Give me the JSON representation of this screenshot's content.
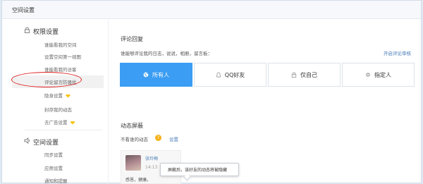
{
  "header": {
    "title": "空间设置"
  },
  "sidebar": {
    "permissions": {
      "title": "权限设置",
      "items": [
        {
          "label": "谁能看我的空间"
        },
        {
          "label": "设置空间第一视图"
        },
        {
          "label": "谁能看我的访客"
        },
        {
          "label": "评论留言防骚扰"
        },
        {
          "label": "隐身设置"
        },
        {
          "label": "封存我的动态"
        },
        {
          "label": "去广告设置"
        }
      ]
    },
    "space": {
      "title": "空间设置",
      "items": [
        {
          "label": "同步设置"
        },
        {
          "label": "应用设置"
        },
        {
          "label": "通知和提醒"
        }
      ]
    }
  },
  "main": {
    "comment": {
      "title": "评论回复",
      "desc": "谁能够评论我的日志，说说，相册，留言板：",
      "link": "开启评论审核",
      "options": [
        {
          "label": "所有人",
          "icon": "globe-icon",
          "selected": true
        },
        {
          "label": "QQ好友",
          "icon": "person-icon",
          "selected": false
        },
        {
          "label": "仅自己",
          "icon": "lock-icon",
          "selected": false
        },
        {
          "label": "指定人",
          "icon": "gear-icon",
          "selected": false
        }
      ]
    },
    "feed": {
      "title": "动态屏蔽",
      "filter_label": "不看谁的动态",
      "help": "?",
      "settings_link": "设置",
      "card": {
        "name": "张玲梅",
        "time": "14:13",
        "text": "感恩，健康。"
      },
      "tooltip": "屏蔽后，该好友的动态将被隐藏"
    }
  },
  "colors": {
    "accent": "#3b9df3",
    "highlight": "#e02020"
  }
}
